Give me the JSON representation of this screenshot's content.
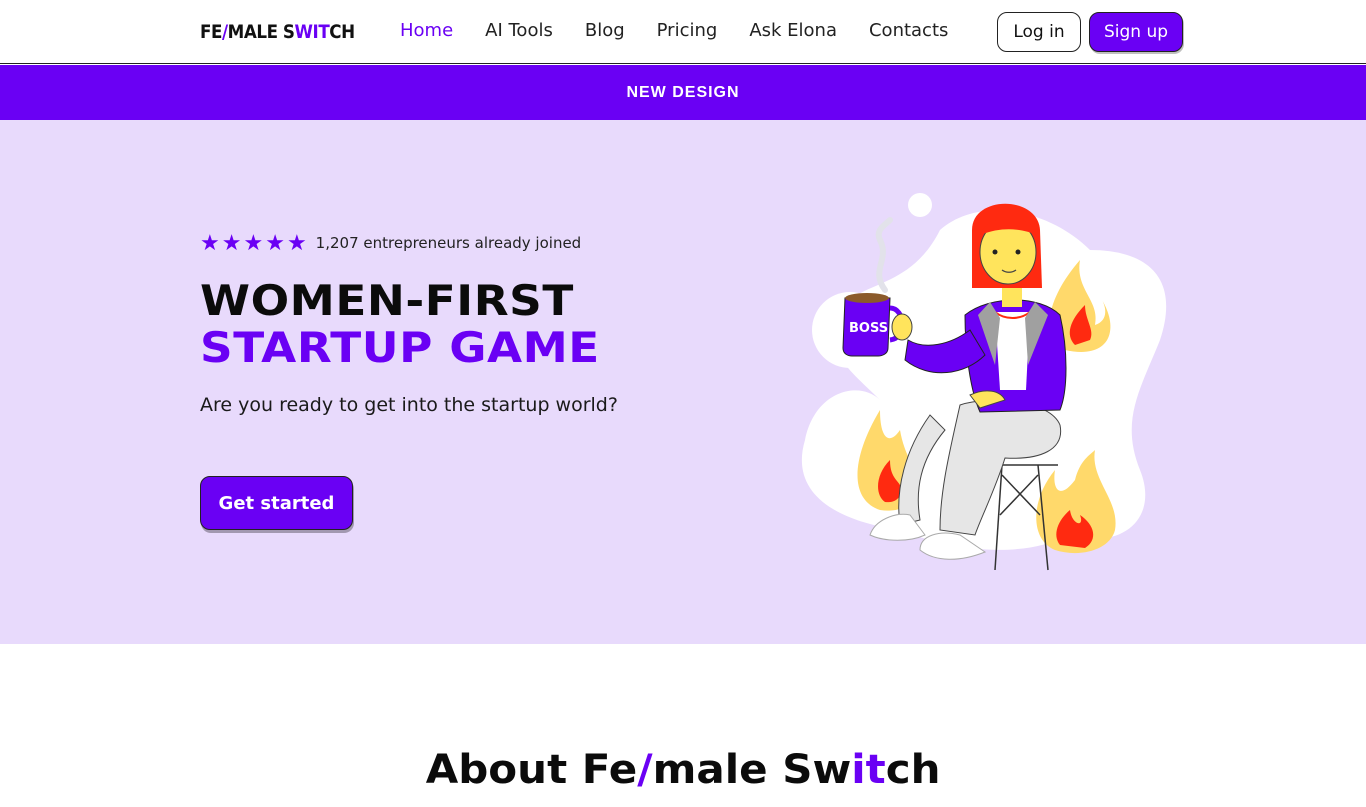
{
  "header": {
    "logo": {
      "part1": "FE",
      "slash": "/",
      "part2": "MALE S",
      "accent": "WIT",
      "part3": "CH"
    },
    "nav": [
      {
        "label": "Home",
        "active": true
      },
      {
        "label": "AI Tools",
        "active": false
      },
      {
        "label": "Blog",
        "active": false
      },
      {
        "label": "Pricing",
        "active": false
      },
      {
        "label": "Ask Elona",
        "active": false
      },
      {
        "label": "Contacts",
        "active": false
      }
    ],
    "login_label": "Log in",
    "signup_label": "Sign up"
  },
  "banner": {
    "text": "NEW DESIGN"
  },
  "hero": {
    "stars": 5,
    "joined_text": "1,207 entrepreneurs already joined",
    "title_line1": "WOMEN-FIRST",
    "title_line2": "STARTUP GAME",
    "subtitle": "Are you ready to get into the startup world?",
    "cta_label": "Get started",
    "illustration": {
      "mug_text": "BOSS"
    }
  },
  "about": {
    "part1": "About Fe",
    "slash": "/",
    "part2": "male Sw",
    "accent": "it",
    "part3": "ch"
  },
  "colors": {
    "accent": "#6a00f4",
    "hero_bg": "#e8dafc",
    "flame": "#ffd96b",
    "flame_inner": "#ff2a10",
    "hair": "#ff2a10"
  }
}
